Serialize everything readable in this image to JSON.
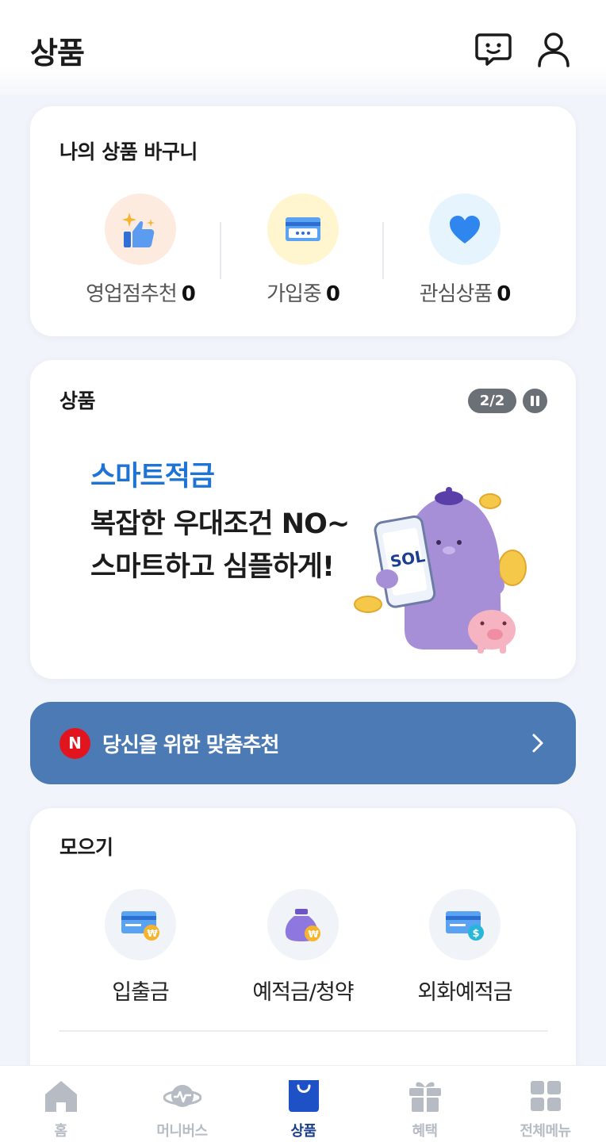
{
  "header": {
    "title": "상품"
  },
  "basket": {
    "title": "나의 상품 바구니",
    "items": [
      {
        "label": "영업점추천",
        "count": "0",
        "icon": "thumbs-up-icon"
      },
      {
        "label": "가입중",
        "count": "0",
        "icon": "card-icon"
      },
      {
        "label": "관심상품",
        "count": "0",
        "icon": "heart-icon"
      }
    ]
  },
  "products": {
    "title": "상품",
    "pager": "2/2",
    "banner": {
      "subtitle": "스마트적금",
      "line1": "복잡한 우대조건 NO~",
      "line2": "스마트하고 심플하게!"
    }
  },
  "reco": {
    "badge": "N",
    "text": "당신을 위한 맞춤추천"
  },
  "save": {
    "title": "모으기",
    "items": [
      {
        "label": "입출금",
        "icon": "won-card-icon"
      },
      {
        "label": "예적금/청약",
        "icon": "money-bag-icon"
      },
      {
        "label": "외화예적금",
        "icon": "dollar-card-icon"
      }
    ]
  },
  "nav": {
    "items": [
      {
        "label": "홈",
        "icon": "home-icon",
        "active": false
      },
      {
        "label": "머니버스",
        "icon": "planet-icon",
        "active": false
      },
      {
        "label": "상품",
        "icon": "shopping-bag-icon",
        "active": true
      },
      {
        "label": "혜택",
        "icon": "gift-icon",
        "active": false
      },
      {
        "label": "전체메뉴",
        "icon": "grid-icon",
        "active": false
      }
    ]
  },
  "colors": {
    "accent_blue": "#1e74d6",
    "reco_bar": "#4b7ab4",
    "nav_active": "#1b3e8c",
    "badge_red": "#e2151f"
  }
}
